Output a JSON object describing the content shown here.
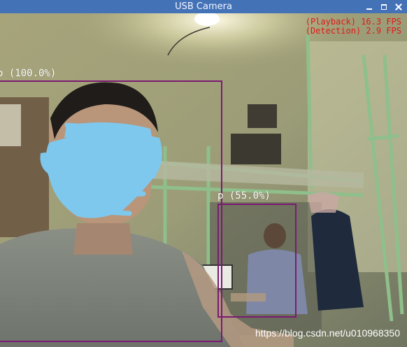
{
  "window": {
    "title": "USB Camera",
    "controls": [
      "minimize-icon",
      "maximize-icon",
      "close-icon"
    ]
  },
  "overlay": {
    "playback_fps": "(Playback) 16.3 FPS",
    "detection_fps": "(Detection) 2.9 FPS"
  },
  "detections": [
    {
      "label": "o (100.0%)"
    },
    {
      "label": "p (55.0%)"
    }
  ],
  "watermark": "https://blog.csdn.net/u010968350",
  "colors": {
    "titlebar": "#4472b7",
    "box": "#7a1a72",
    "fps_text": "#e01818"
  }
}
